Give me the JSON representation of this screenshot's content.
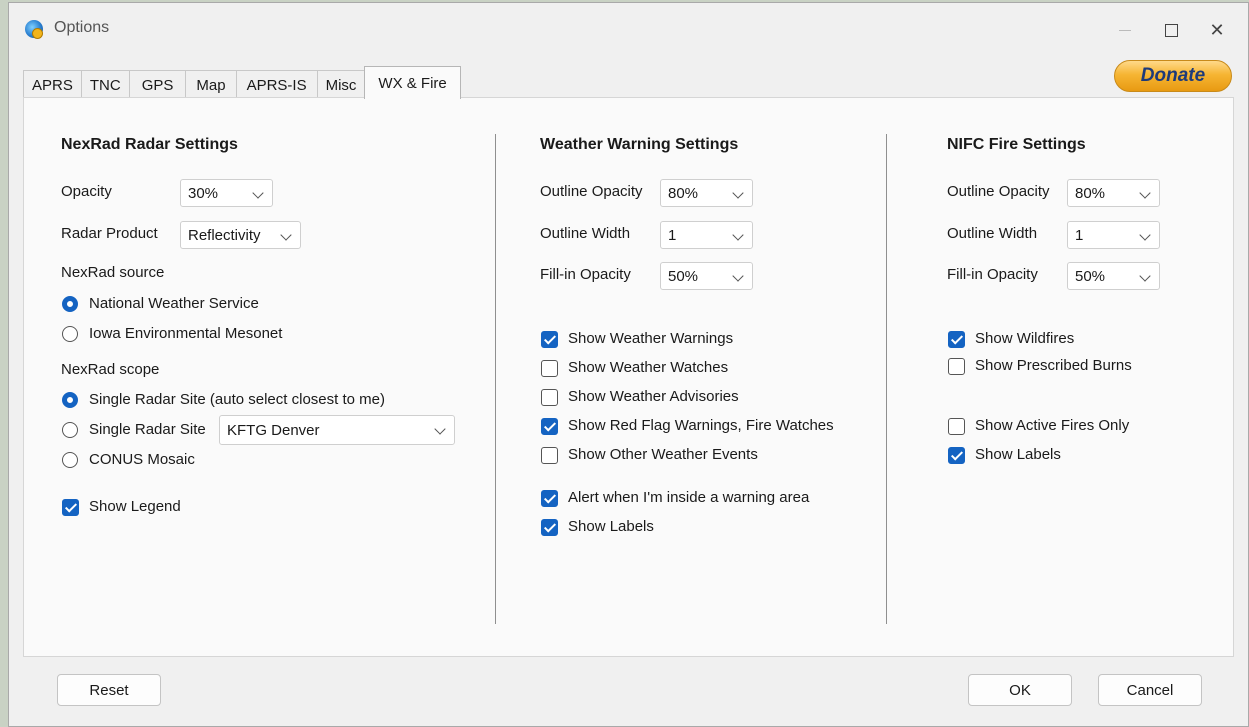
{
  "window": {
    "title": "Options",
    "app_icon": "globe-icon",
    "minimize_icon": "minimize-icon",
    "maximize_icon": "maximize-icon",
    "close_icon": "close-icon"
  },
  "tabs": [
    "APRS",
    "TNC",
    "GPS",
    "Map",
    "APRS-IS",
    "Misc",
    "WX & Fire"
  ],
  "active_tab": "WX & Fire",
  "donate_label": "Donate",
  "nexrad": {
    "heading": "NexRad Radar Settings",
    "opacity_label": "Opacity",
    "opacity_value": "30%",
    "product_label": "Radar Product",
    "product_value": "Reflectivity",
    "source_label": "NexRad source",
    "source_options": [
      "National Weather Service",
      "Iowa Environmental Mesonet"
    ],
    "source_selected": 0,
    "scope_label": "NexRad scope",
    "scope_options": [
      "Single Radar Site (auto select closest to me)",
      "Single Radar Site",
      "CONUS Mosaic"
    ],
    "scope_selected": 0,
    "site_value": "KFTG  Denver",
    "show_legend_label": "Show Legend",
    "show_legend": true
  },
  "weather": {
    "heading": "Weather Warning Settings",
    "outline_opacity_label": "Outline Opacity",
    "outline_opacity_value": "80%",
    "outline_width_label": "Outline Width",
    "outline_width_value": "1",
    "fill_opacity_label": "Fill-in Opacity",
    "fill_opacity_value": "50%",
    "checks": [
      {
        "label": "Show Weather Warnings",
        "checked": true
      },
      {
        "label": "Show Weather Watches",
        "checked": false
      },
      {
        "label": "Show Weather Advisories",
        "checked": false
      },
      {
        "label": "Show Red Flag Warnings, Fire Watches",
        "checked": true
      },
      {
        "label": "Show Other Weather Events",
        "checked": false
      },
      {
        "label": "Alert when I'm inside a warning area",
        "checked": true
      },
      {
        "label": "Show Labels",
        "checked": true
      }
    ]
  },
  "fire": {
    "heading": "NIFC Fire Settings",
    "outline_opacity_label": "Outline Opacity",
    "outline_opacity_value": "80%",
    "outline_width_label": "Outline Width",
    "outline_width_value": "1",
    "fill_opacity_label": "Fill-in Opacity",
    "fill_opacity_value": "50%",
    "checks": [
      {
        "label": "Show Wildfires",
        "checked": true
      },
      {
        "label": "Show Prescribed Burns",
        "checked": false
      },
      {
        "label": "Show Active Fires Only",
        "checked": false
      },
      {
        "label": "Show Labels",
        "checked": true
      }
    ]
  },
  "footer": {
    "reset_label": "Reset",
    "ok_label": "OK",
    "cancel_label": "Cancel"
  },
  "colors": {
    "accent": "#1463c2",
    "donate": "#f6b533"
  }
}
